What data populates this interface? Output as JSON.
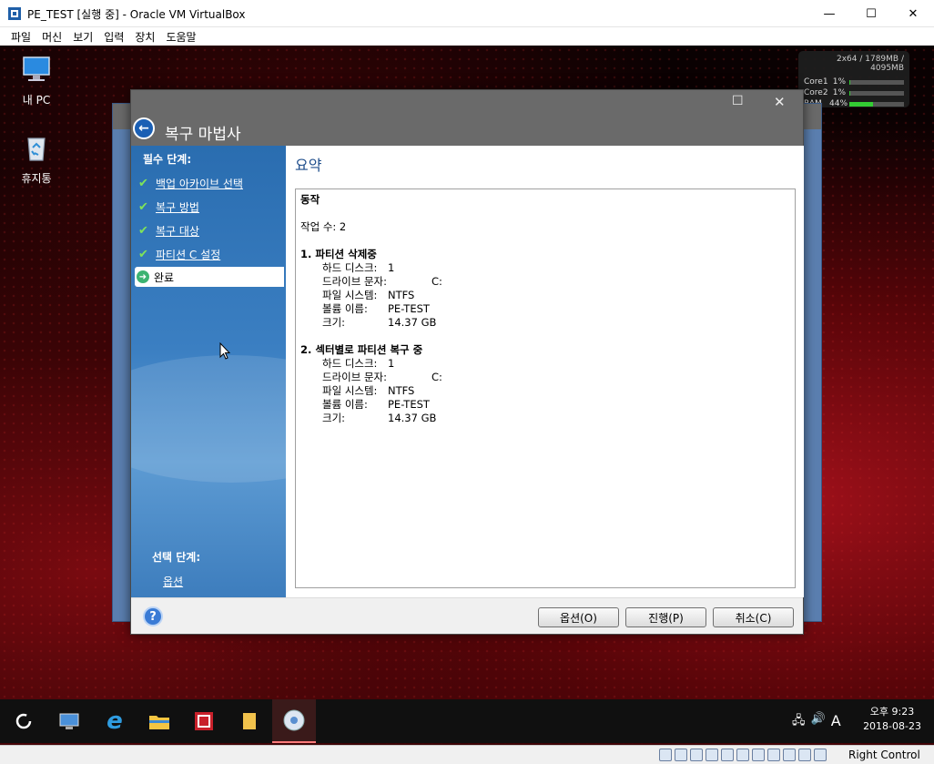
{
  "vbox": {
    "title": "PE_TEST [실행 중] - Oracle VM VirtualBox",
    "menu": [
      "파일",
      "머신",
      "보기",
      "입력",
      "장치",
      "도움말"
    ],
    "host_key": "Right Control"
  },
  "desktop": {
    "icons": [
      {
        "label": "내 PC",
        "icon": "computer-icon"
      },
      {
        "label": "휴지통",
        "icon": "recycle-bin-icon"
      }
    ]
  },
  "sysmon": {
    "header": "2x64 / 1789MB / 4095MB",
    "rows": [
      {
        "label": "Core1",
        "pct": "1%",
        "fill": 0.01
      },
      {
        "label": "Core2",
        "pct": "1%",
        "fill": 0.01
      },
      {
        "label": "RAM",
        "pct": "44%",
        "fill": 0.44
      }
    ]
  },
  "dialog": {
    "title": "복구 마법사",
    "sidebar": {
      "required_heading": "필수 단계:",
      "steps": [
        "백업 아카이브 선택",
        "복구 방법",
        "복구 대상",
        "파티션 C 설정"
      ],
      "active_step": "완료",
      "optional_heading": "선택 단계:",
      "optional_link": "옵션"
    },
    "content_title": "요약",
    "summary": {
      "section": "동작",
      "task_count": "작업 수: 2",
      "ops": [
        {
          "title": "1. 파티션 삭제중",
          "fields": [
            {
              "k": "하드 디스크:",
              "v": "1"
            },
            {
              "k": "드라이브 문자:",
              "v": "C:"
            },
            {
              "k": "파일 시스템:",
              "v": "NTFS"
            },
            {
              "k": "볼륨 이름:",
              "v": "PE-TEST"
            },
            {
              "k": "크기:",
              "v": "14.37 GB"
            }
          ]
        },
        {
          "title": "2. 섹터별로 파티션 복구 중",
          "fields": [
            {
              "k": "하드 디스크:",
              "v": "1"
            },
            {
              "k": "드라이브 문자:",
              "v": "C:"
            },
            {
              "k": "파일 시스템:",
              "v": "NTFS"
            },
            {
              "k": "볼륨 이름:",
              "v": "PE-TEST"
            },
            {
              "k": "크기:",
              "v": "14.37 GB"
            }
          ]
        }
      ]
    },
    "buttons": {
      "options": "옵션(O)",
      "proceed": "진행(P)",
      "cancel": "취소(C)"
    }
  },
  "taskbar": {
    "time": "오후 9:23",
    "date": "2018-08-23",
    "ime": "A"
  }
}
